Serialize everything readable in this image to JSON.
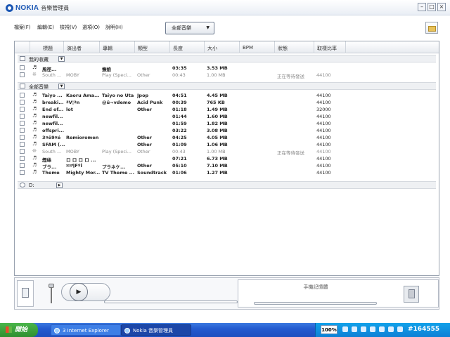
{
  "window": {
    "brand": "NOKIA",
    "title": "音樂管理員",
    "controls": [
      "–",
      "□",
      "×"
    ]
  },
  "menu": [
    "檔案(F)",
    "編輯(E)",
    "檢視(V)",
    "選項(O)",
    "說明(H)"
  ],
  "filter": {
    "selected": "全部音樂",
    "caret": "▼"
  },
  "columns": [
    "標題",
    "演出者",
    "專輯",
    "類型",
    "長度",
    "大小",
    "BPM",
    "狀態",
    "取樣比率"
  ],
  "groups": {
    "favorites": "我的收藏",
    "all": "全部音樂",
    "drive": "D:"
  },
  "favorites_rows": [
    {
      "icon": "♬",
      "title": "風徑...",
      "artist": "",
      "album": "撫娘",
      "genre": "",
      "length": "03:35",
      "size": "3.53 MB",
      "bpm": "",
      "status": "",
      "rate": "",
      "dim": false
    },
    {
      "icon": "❊",
      "title": "South ...",
      "artist": "MOBY",
      "album": "Play (Speci...",
      "genre": "Other",
      "length": "00:43",
      "size": "1.00 MB",
      "bpm": "",
      "status": "正在等待發送",
      "rate": "44100",
      "dim": true
    }
  ],
  "all_rows": [
    {
      "icon": "♬",
      "title": "Taiyo ...",
      "artist": "Kaoru Ama...",
      "album": "Taiyo no Uta",
      "genre": "Jpop",
      "length": "04:51",
      "size": "4.45 MB",
      "bpm": "",
      "status": "",
      "rate": "44100",
      "dim": false
    },
    {
      "icon": "♬",
      "title": "breaki...",
      "artist": "ªV¦ªn",
      "album": "@ü¬vdemo",
      "genre": "Acid Punk",
      "length": "00:39",
      "size": "765 KB",
      "bpm": "",
      "status": "",
      "rate": "44100",
      "dim": false
    },
    {
      "icon": "♬",
      "title": "End of...",
      "artist": "lot",
      "album": "",
      "genre": "Other",
      "length": "01:18",
      "size": "1.49 MB",
      "bpm": "",
      "status": "",
      "rate": "32000",
      "dim": false
    },
    {
      "icon": "♬",
      "title": "newfil...",
      "artist": "",
      "album": "",
      "genre": "",
      "length": "01:44",
      "size": "1.60 MB",
      "bpm": "",
      "status": "",
      "rate": "44100",
      "dim": false
    },
    {
      "icon": "♬",
      "title": "newfil...",
      "artist": "",
      "album": "",
      "genre": "",
      "length": "01:59",
      "size": "1.82 MB",
      "bpm": "",
      "status": "",
      "rate": "44100",
      "dim": false
    },
    {
      "icon": "♬",
      "title": "offspri...",
      "artist": "",
      "album": "",
      "genre": "",
      "length": "03:22",
      "size": "3.08 MB",
      "bpm": "",
      "status": "",
      "rate": "44100",
      "dim": false
    },
    {
      "icon": "♬",
      "title": "3¤ë9¤é",
      "artist": "Remioromen",
      "album": "",
      "genre": "Other",
      "length": "04:25",
      "size": "4.05 MB",
      "bpm": "",
      "status": "",
      "rate": "44100",
      "dim": false
    },
    {
      "icon": "♬",
      "title": "SFAM (...",
      "artist": "",
      "album": "",
      "genre": "Other",
      "length": "01:09",
      "size": "1.06 MB",
      "bpm": "",
      "status": "",
      "rate": "44100",
      "dim": false
    },
    {
      "icon": "❊",
      "title": "South ...",
      "artist": "MOBY",
      "album": "Play (Speci...",
      "genre": "Other",
      "length": "00:43",
      "size": "1.00 MB",
      "bpm": "",
      "status": "正在等待發送",
      "rate": "44100",
      "dim": true
    },
    {
      "icon": "♬",
      "title": "煙絲",
      "artist": "ロ ロ ロ ロ ...",
      "album": "",
      "genre": "",
      "length": "07:21",
      "size": "6.73 MB",
      "bpm": "",
      "status": "",
      "rate": "44100",
      "dim": false
    },
    {
      "icon": "♬",
      "title": "ブラ...",
      "artist": "¤¤¶FºÍ",
      "album": "プラネケ...",
      "genre": "Other",
      "length": "05:10",
      "size": "7.10 MB",
      "bpm": "",
      "status": "",
      "rate": "44100",
      "dim": false
    },
    {
      "icon": "♬",
      "title": "Theme",
      "artist": "Mighty Mor...",
      "album": "TV Theme ...",
      "genre": "Soundtrack",
      "length": "01:06",
      "size": "1.27 MB",
      "bpm": "",
      "status": "",
      "rate": "44100",
      "dim": false
    }
  ],
  "player": {
    "play_glyph": "▶",
    "memory_label": "手機記憶體"
  },
  "taskbar": {
    "start": "開始",
    "tasks": [
      "3 Internet Explorer",
      "Nokia 音樂管理員"
    ],
    "zoom": "100%",
    "id": "#164555"
  }
}
